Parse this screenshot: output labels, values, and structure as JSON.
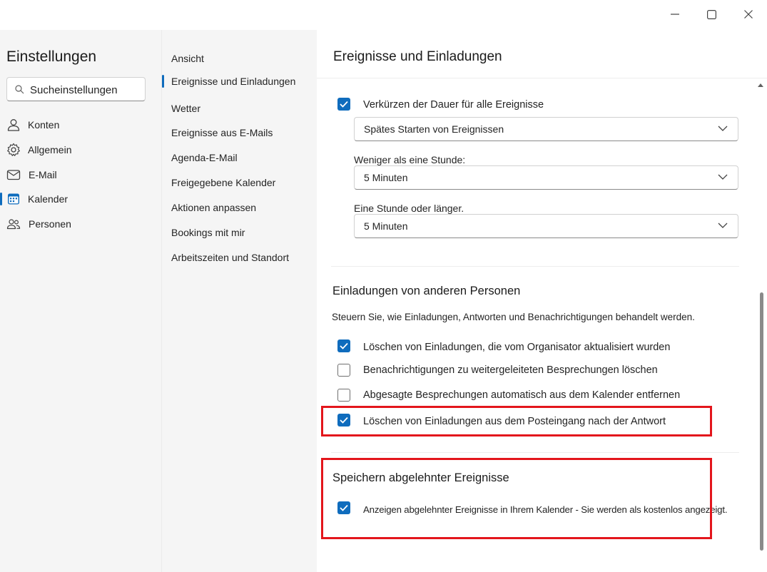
{
  "window": {
    "controls": {
      "minimize_icon": "minimize-icon",
      "maximize_icon": "maximize-icon",
      "close_icon": "close-icon"
    }
  },
  "sidebar": {
    "title": "Einstellungen",
    "search_placeholder": "Sucheinstellungen",
    "items": [
      {
        "label": "Konten",
        "icon": "person-icon"
      },
      {
        "label": "Allgemein",
        "icon": "gear-icon"
      },
      {
        "label": "E-Mail",
        "icon": "mail-icon"
      },
      {
        "label": "Kalender",
        "icon": "calendar-icon",
        "selected": true
      },
      {
        "label": "Personen",
        "icon": "people-icon"
      }
    ]
  },
  "subnav": {
    "items": [
      {
        "label": "Ansicht"
      },
      {
        "label": "Ereignisse und Einladungen",
        "selected": true
      },
      {
        "label": "Wetter"
      },
      {
        "label": "Ereignisse aus E-Mails"
      },
      {
        "label": "Agenda-E-Mail"
      },
      {
        "label": "Freigegebene Kalender"
      },
      {
        "label": "Aktionen anpassen"
      },
      {
        "label": "Bookings mit mir"
      },
      {
        "label": "Arbeitszeiten und Standort"
      }
    ]
  },
  "main": {
    "title": "Ereignisse und Einladungen",
    "shorten": {
      "checkbox_label": "Verkürzen der Dauer für alle Ereignisse",
      "checked": true,
      "mode_value": "Spätes Starten von Ereignissen",
      "under_hour_label": "Weniger als eine Stunde:",
      "under_hour_value": "5 Minuten",
      "over_hour_label": "Eine Stunde oder länger.",
      "over_hour_value": "5 Minuten"
    },
    "invitations": {
      "title": "Einladungen von anderen Personen",
      "description": "Steuern Sie, wie Einladungen, Antworten und Benachrichtigungen behandelt werden.",
      "options": [
        {
          "label": "Löschen von Einladungen, die vom Organisator aktualisiert wurden",
          "checked": true
        },
        {
          "label": "Benachrichtigungen zu weitergeleiteten Besprechungen löschen",
          "checked": false
        },
        {
          "label": "Abgesagte Besprechungen automatisch aus dem Kalender entfernen",
          "checked": false
        },
        {
          "label": "Löschen von Einladungen aus dem Posteingang nach der Antwort",
          "checked": true
        }
      ]
    },
    "declined": {
      "title": "Speichern abgelehnter Ereignisse",
      "option_label": "Anzeigen abgelehnter Ereignisse in Ihrem Kalender - Sie werden als kostenlos angezeigt.",
      "checked": true
    }
  },
  "colors": {
    "accent": "#0f6cbd",
    "highlight": "#e3161c"
  }
}
